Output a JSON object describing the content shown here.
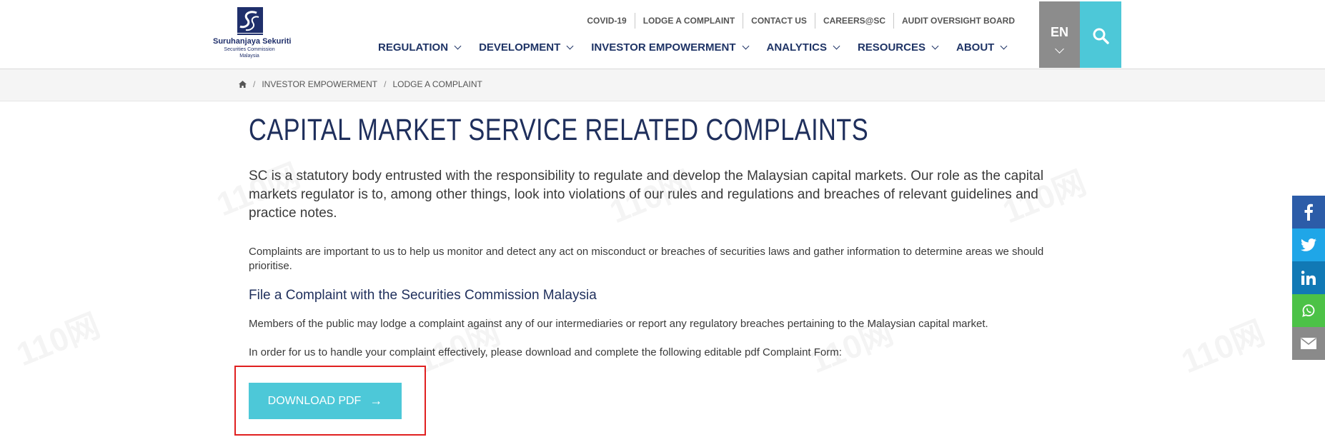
{
  "logo": {
    "line1": "Suruhanjaya Sekuriti",
    "line2": "Securities Commission",
    "line3": "Malaysia"
  },
  "utility_nav": [
    "COVID-19",
    "LODGE A COMPLAINT",
    "CONTACT US",
    "CAREERS@SC",
    "AUDIT OVERSIGHT BOARD"
  ],
  "main_nav": [
    "REGULATION",
    "DEVELOPMENT",
    "INVESTOR EMPOWERMENT",
    "ANALYTICS",
    "RESOURCES",
    "ABOUT"
  ],
  "language": {
    "code": "EN"
  },
  "breadcrumb": {
    "icon": "home-icon",
    "items": [
      "INVESTOR EMPOWERMENT",
      "LODGE A COMPLAINT"
    ],
    "separator": "/"
  },
  "page": {
    "title": "CAPITAL MARKET SERVICE RELATED COMPLAINTS",
    "lead": "SC is a statutory body entrusted with the responsibility to regulate and develop the Malaysian capital markets. Our role as the capital markets regulator is to, among other things, look into violations of our rules and regulations and breaches of relevant guidelines and practice notes.",
    "para1": "Complaints are important to us to help us monitor and detect any act on misconduct or breaches of securities laws and gather information to determine areas we should prioritise.",
    "subheading": "File a Complaint with the Securities Commission Malaysia",
    "para2": "Members of the public may lodge a complaint against any of our intermediaries or report any regulatory breaches pertaining to the Malaysian capital market.",
    "para3": "In order for us to handle your complaint effectively, please download and complete the following editable pdf Complaint Form:",
    "download_label": "DOWNLOAD PDF",
    "download_arrow": "→"
  },
  "social": [
    "facebook-icon",
    "twitter-icon",
    "linkedin-icon",
    "whatsapp-icon",
    "email-icon"
  ],
  "watermark": {
    "text": "110网"
  },
  "colors": {
    "navy": "#1f2f5c",
    "accent": "#4dc8d8",
    "lang_bg": "#8c8c8c",
    "highlight_border": "#e02020",
    "facebook": "#2c5ca8",
    "twitter": "#1fa6e8",
    "linkedin": "#1179b5",
    "whatsapp": "#4cc247",
    "email": "#8a8a8a"
  }
}
